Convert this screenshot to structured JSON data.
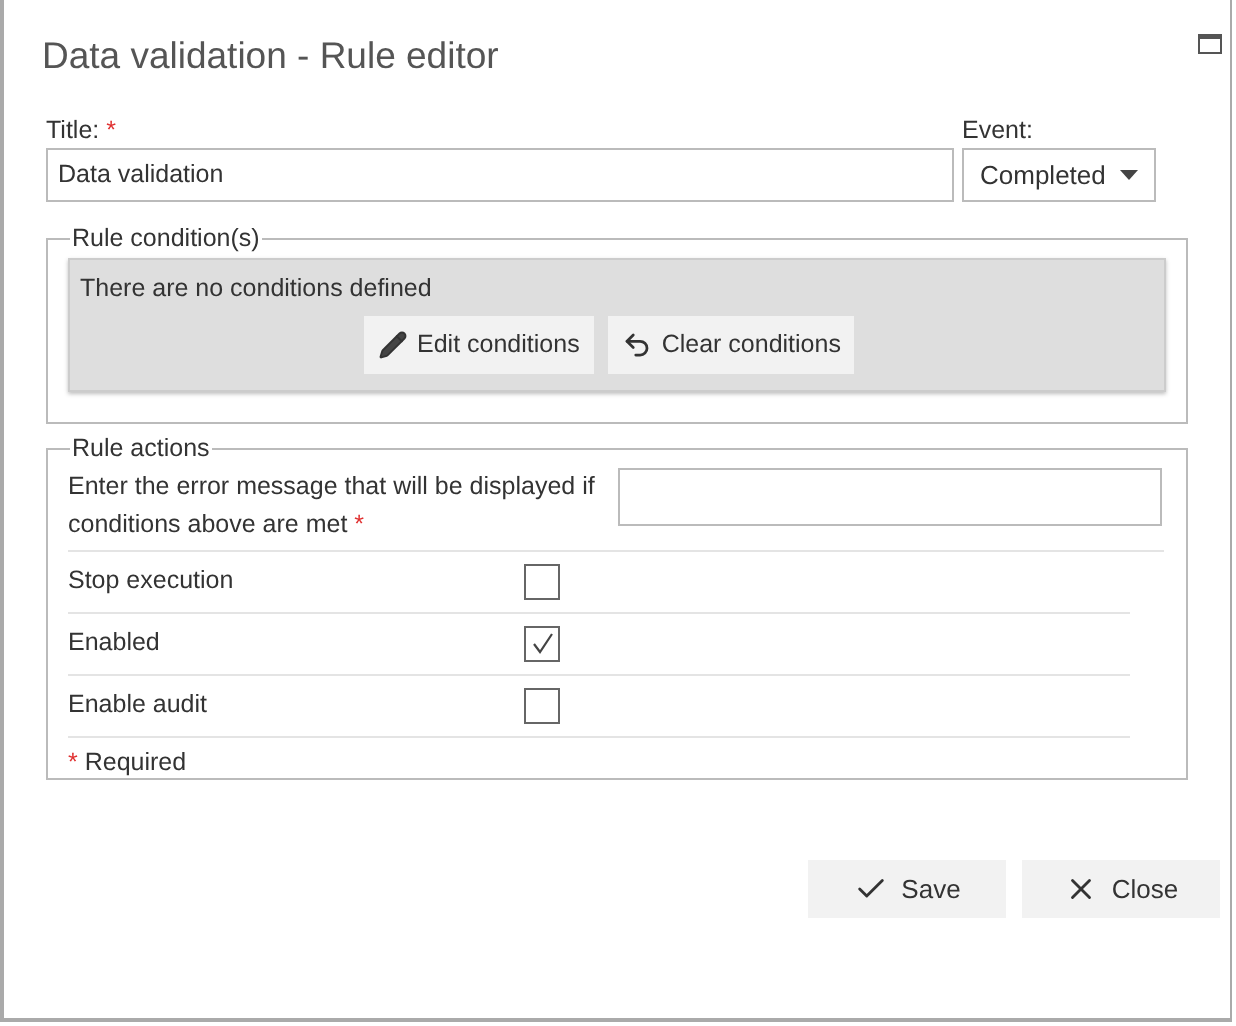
{
  "window": {
    "title": "Data validation - Rule editor"
  },
  "title_field": {
    "label": "Title:",
    "required_mark": "*",
    "value": "Data validation"
  },
  "event_field": {
    "label": "Event:",
    "value": "Completed"
  },
  "conditions": {
    "legend": "Rule condition(s)",
    "message": "There are no conditions defined",
    "buttons": [
      {
        "kind": "edit",
        "label": "Edit conditions"
      },
      {
        "kind": "clear",
        "label": "Clear conditions"
      }
    ]
  },
  "actions": {
    "legend": "Rule actions",
    "error_label": "Enter the error message that will be displayed if conditions above are met",
    "error_required_mark": "*",
    "options": [
      {
        "label": "Stop execution",
        "checked": false
      },
      {
        "label": "Enabled",
        "checked": true
      },
      {
        "label": "Enable audit",
        "checked": false
      }
    ],
    "required_mark": "*",
    "required_note": "Required"
  },
  "buttons": [
    {
      "kind": "save",
      "label": "Save"
    },
    {
      "kind": "close",
      "label": "Close"
    }
  ]
}
